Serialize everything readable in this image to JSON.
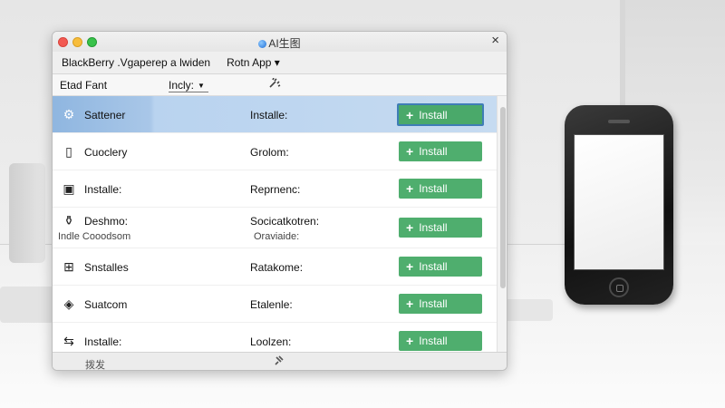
{
  "window": {
    "title": "AI生图",
    "close": "×"
  },
  "menubar": {
    "items": [
      "BlackBerry .Vgaperep a lwiden",
      "Rotn App ▾"
    ]
  },
  "toolbar": {
    "font_label": "Etad Fant",
    "select_value": "Incly:",
    "icon": "magic-icon"
  },
  "rows": [
    {
      "name": "Sattener",
      "status": "Installe:",
      "button": "Install",
      "icon": "gear-icon",
      "glyph": "⚙"
    },
    {
      "name": "Cuoclery",
      "status": "Grolom:",
      "button": "Install",
      "icon": "frame-icon",
      "glyph": "▯"
    },
    {
      "name": "Installe:",
      "status": "Reprnenc:",
      "button": "Install",
      "icon": "device-icon",
      "glyph": "▣"
    },
    {
      "name": "Deshmo:",
      "sub": "Indle Cooodsom",
      "status": "Socicatkotren:",
      "status2": "Oraviaide:",
      "button": "Install",
      "icon": "bottle-icon",
      "glyph": "⚱"
    },
    {
      "name": "Snstalles",
      "status": "Ratakome:",
      "button": "Install",
      "icon": "grid-icon",
      "glyph": "⊞"
    },
    {
      "name": "Suatcom",
      "status": "Etalenle:",
      "button": "Install",
      "icon": "cube-icon",
      "glyph": "◈"
    },
    {
      "name": "Installe:",
      "status": "Loolzen:",
      "button": "Install",
      "icon": "swap-icon",
      "glyph": "⇆"
    }
  ],
  "statusbar": {
    "text": "拨发",
    "icon": "pin-icon"
  },
  "colors": {
    "install_green": "#4fae6e",
    "selected_blue": "#b9d3ef"
  }
}
